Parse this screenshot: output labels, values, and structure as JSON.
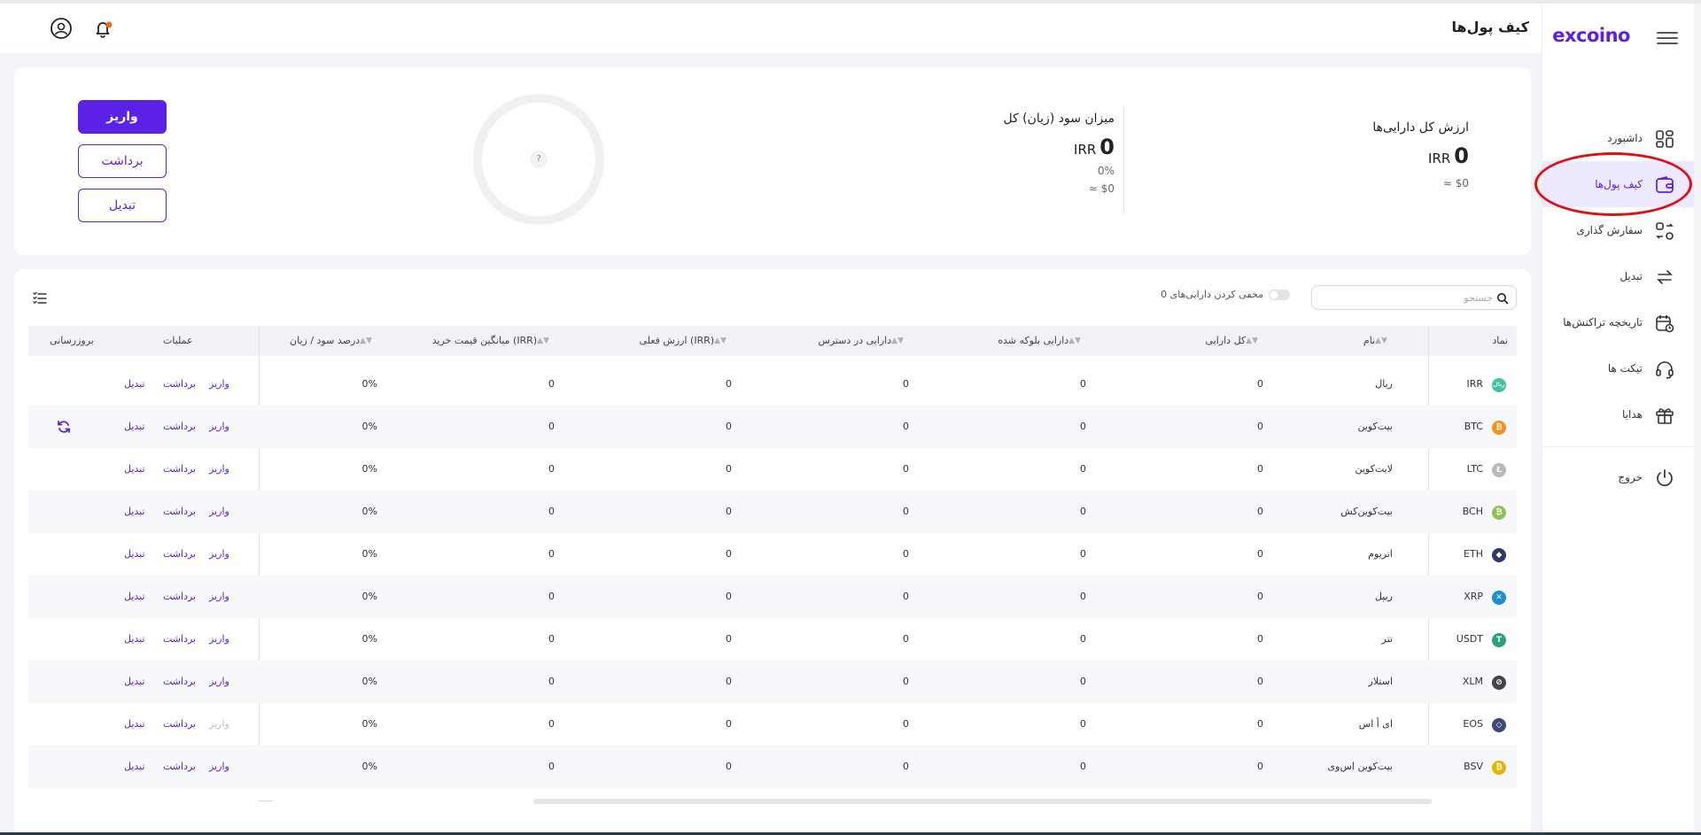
{
  "sidebar": {
    "logo": "excoino",
    "items": [
      {
        "label": "داشبورد",
        "icon": "dashboard-icon"
      },
      {
        "label": "کیف پول‌ها",
        "icon": "wallet-icon"
      },
      {
        "label": "سفارش گذاری",
        "icon": "order-icon"
      },
      {
        "label": "تبدیل",
        "icon": "convert-icon"
      },
      {
        "label": "تاریخچه تراکنش‌ها",
        "icon": "history-icon"
      },
      {
        "label": "تیکت ها",
        "icon": "headset-icon"
      },
      {
        "label": "هدایا",
        "icon": "gift-icon"
      }
    ],
    "logout": "خروج"
  },
  "header": {
    "title": "کیف پول‌ها"
  },
  "summary": {
    "total_title": "ارزش کل دارایی‌ها",
    "total_value": "0",
    "total_currency": "IRR",
    "total_usd": "≈ $0",
    "profit_title": "میزان سود (زیان) کل",
    "profit_value": "0",
    "profit_currency": "IRR",
    "profit_percent": "0%",
    "profit_usd": "≈ $0",
    "chart_placeholder": "?",
    "buttons": {
      "deposit": "واریز",
      "withdraw": "برداشت",
      "convert": "تبدیل"
    }
  },
  "table": {
    "search_placeholder": "جستجو",
    "hide_label": "مخفی کردن دارایی‌های 0",
    "columns": {
      "symbol": "نماد",
      "name": "نام",
      "total": "کل دارایی",
      "blocked": "دارایی بلوکه شده",
      "available": "دارایی در دسترس",
      "current_value": "ارزش فعلی (IRR)",
      "avg_price": "میانگین قیمت خرید (IRR)",
      "profit_percent": "درصد سود / زیان",
      "operations": "عملیات",
      "update": "بروزرسانی"
    },
    "actions": {
      "deposit": "واریز",
      "withdraw": "برداشت",
      "convert": "تبدیل"
    },
    "rows": [
      {
        "symbol": "IRR",
        "name": "ریال",
        "total": "0",
        "blocked": "0",
        "available": "0",
        "current_value": "0",
        "avg_price": "0",
        "profit": "0%",
        "color": "#3cc5a3",
        "glyph": "ریال",
        "refresh": false,
        "deposit_disabled": false
      },
      {
        "symbol": "BTC",
        "name": "بیت‌کوین",
        "total": "0",
        "blocked": "0",
        "available": "0",
        "current_value": "0",
        "avg_price": "0",
        "profit": "0%",
        "color": "#f7931a",
        "glyph": "₿",
        "refresh": true,
        "deposit_disabled": false
      },
      {
        "symbol": "LTC",
        "name": "لایت‌کوین",
        "total": "0",
        "blocked": "0",
        "available": "0",
        "current_value": "0",
        "avg_price": "0",
        "profit": "0%",
        "color": "#b8b8b8",
        "glyph": "Ł",
        "refresh": false,
        "deposit_disabled": false
      },
      {
        "symbol": "BCH",
        "name": "بیت‌کوین‌کش",
        "total": "0",
        "blocked": "0",
        "available": "0",
        "current_value": "0",
        "avg_price": "0",
        "profit": "0%",
        "color": "#8dc351",
        "glyph": "₿",
        "refresh": false,
        "deposit_disabled": false
      },
      {
        "symbol": "ETH",
        "name": "اتریوم",
        "total": "0",
        "blocked": "0",
        "available": "0",
        "current_value": "0",
        "avg_price": "0",
        "profit": "0%",
        "color": "#2f3a6b",
        "glyph": "◆",
        "refresh": false,
        "deposit_disabled": false
      },
      {
        "symbol": "XRP",
        "name": "ریپل",
        "total": "0",
        "blocked": "0",
        "available": "0",
        "current_value": "0",
        "avg_price": "0",
        "profit": "0%",
        "color": "#1d8fd6",
        "glyph": "✕",
        "refresh": false,
        "deposit_disabled": false
      },
      {
        "symbol": "USDT",
        "name": "تتر",
        "total": "0",
        "blocked": "0",
        "available": "0",
        "current_value": "0",
        "avg_price": "0",
        "profit": "0%",
        "color": "#26a17b",
        "glyph": "T",
        "refresh": false,
        "deposit_disabled": false
      },
      {
        "symbol": "XLM",
        "name": "استلار",
        "total": "0",
        "blocked": "0",
        "available": "0",
        "current_value": "0",
        "avg_price": "0",
        "profit": "0%",
        "color": "#444444",
        "glyph": "⊘",
        "refresh": false,
        "deposit_disabled": false
      },
      {
        "symbol": "EOS",
        "name": "ای أ اس",
        "total": "0",
        "blocked": "0",
        "available": "0",
        "current_value": "0",
        "avg_price": "0",
        "profit": "0%",
        "color": "#3b4a7a",
        "glyph": "◇",
        "refresh": false,
        "deposit_disabled": true
      },
      {
        "symbol": "BSV",
        "name": "بیت‌کوین اس‌وی",
        "total": "0",
        "blocked": "0",
        "available": "0",
        "current_value": "0",
        "avg_price": "0",
        "profit": "0%",
        "color": "#eab300",
        "glyph": "₿",
        "refresh": false,
        "deposit_disabled": false
      }
    ]
  }
}
